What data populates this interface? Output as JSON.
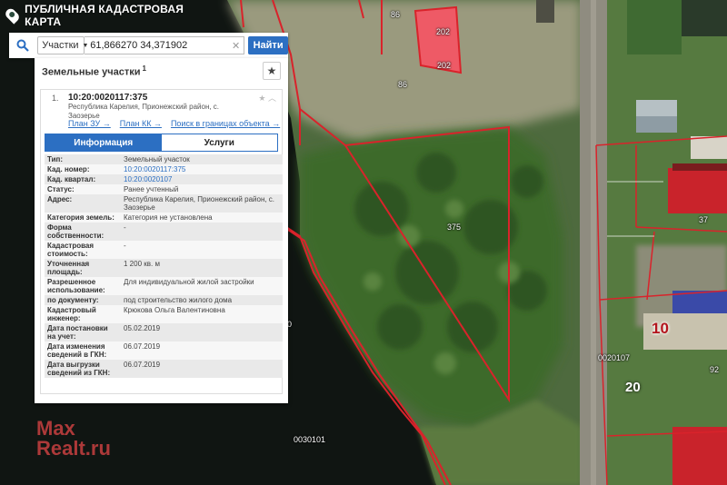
{
  "app": {
    "title": "ПУБЛИЧНАЯ КАДАСТРОВАЯ КАРТА"
  },
  "search": {
    "type_label": "Участки",
    "query": "61,866270 34,371902",
    "find_label": "Найти"
  },
  "results": {
    "title": "Земельные участки",
    "count": "1",
    "item": {
      "index": "1.",
      "cad_number": "10:20:0020117:375",
      "address": "Республика Карелия, Прионежский район, с. Заозерье",
      "links": [
        "План ЗУ →",
        "План КК →",
        "Поиск в границах объекта →"
      ],
      "tabs": [
        "Информация",
        "Услуги"
      ],
      "attributes": [
        {
          "key": "Тип:",
          "value": "Земельный участок",
          "link": false
        },
        {
          "key": "Кад. номер:",
          "value": "10:20:0020117:375",
          "link": true
        },
        {
          "key": "Кад. квартал:",
          "value": "10:20:0020107",
          "link": true
        },
        {
          "key": "Статус:",
          "value": "Ранее учтенный",
          "link": false
        },
        {
          "key": "Адрес:",
          "value": "Республика Карелия, Прионежский район, с. Заозерье",
          "link": false
        },
        {
          "key": "Категория земель:",
          "value": "Категория не установлена",
          "link": false
        },
        {
          "key": "Форма собственности:",
          "value": "-",
          "link": false
        },
        {
          "key": "Кадастровая стоимость:",
          "value": "-",
          "link": false
        },
        {
          "key": "Уточненная площадь:",
          "value": "1 200 кв. м",
          "link": false
        },
        {
          "key": "Разрешенное использование:",
          "value": "Для индивидуальной жилой застройки",
          "link": false
        },
        {
          "key": "по документу:",
          "value": "под строительство жилого дома",
          "link": false
        },
        {
          "key": "Кадастровый инженер:",
          "value": "Крюкова Ольга Валентиновна",
          "link": false
        },
        {
          "key": "Дата постановки на учет:",
          "value": "05.02.2019",
          "link": false
        },
        {
          "key": "Дата изменения сведений в ГКН:",
          "value": "06.07.2019",
          "link": false
        },
        {
          "key": "Дата выгрузки сведений из ГКН:",
          "value": "06.07.2019",
          "link": false
        }
      ]
    }
  },
  "map_labels": {
    "l86a": "86",
    "l86b": "86",
    "l202a": "202",
    "l202b": "202",
    "l375": "375",
    "l37": "37",
    "l10": "10",
    "l20": "20",
    "l92": "92",
    "l0020107": "0020107",
    "l0030101": "0030101",
    "l0": "0"
  },
  "watermark": {
    "line1": "Max",
    "line2": "Realt.ru"
  },
  "colors": {
    "accent": "#2c6fc2",
    "boundary": "#d9232b"
  }
}
